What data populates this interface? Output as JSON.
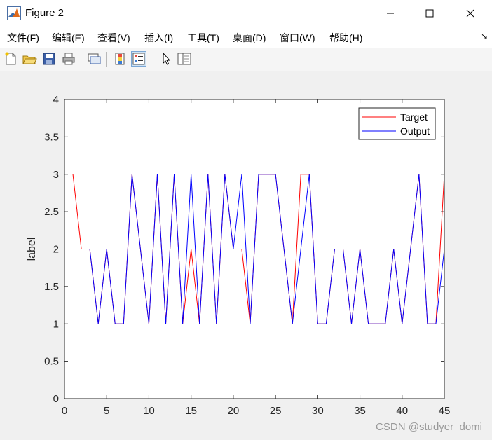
{
  "window": {
    "title": "Figure 2",
    "minimize_icon": "minimize-icon",
    "maximize_icon": "maximize-icon",
    "close_icon": "close-icon"
  },
  "menu": {
    "items": [
      "文件(F)",
      "编辑(E)",
      "查看(V)",
      "插入(I)",
      "工具(T)",
      "桌面(D)",
      "窗口(W)",
      "帮助(H)"
    ],
    "overflow_icon": "dock-arrow-icon"
  },
  "toolbar": {
    "buttons": [
      "new-figure-icon",
      "open-file-icon",
      "save-icon",
      "print-icon",
      "link-plot-icon",
      "colorbar-icon",
      "legend-icon",
      "pointer-icon",
      "property-inspector-icon"
    ]
  },
  "colors": {
    "target": "#ff0000",
    "output": "#0000ff",
    "axes_bg": "#ffffff",
    "figure_bg": "#f0f0f0"
  },
  "chart_data": {
    "type": "line",
    "title": "",
    "xlabel": "",
    "ylabel": "label",
    "xlim": [
      0,
      45
    ],
    "ylim": [
      0,
      4
    ],
    "xticks": [
      0,
      5,
      10,
      15,
      20,
      25,
      30,
      35,
      40,
      45
    ],
    "yticks": [
      0,
      0.5,
      1,
      1.5,
      2,
      2.5,
      3,
      3.5,
      4
    ],
    "ytick_labels": [
      "0",
      "0.5",
      "1",
      "1.5",
      "2",
      "2.5",
      "3",
      "3.5",
      "4"
    ],
    "grid": false,
    "legend_position": "top-right",
    "x": [
      1,
      2,
      3,
      4,
      5,
      6,
      7,
      8,
      9,
      10,
      11,
      12,
      13,
      14,
      15,
      16,
      17,
      18,
      19,
      20,
      21,
      22,
      23,
      24,
      25,
      26,
      27,
      28,
      29,
      30,
      31,
      32,
      33,
      34,
      35,
      36,
      37,
      38,
      39,
      40,
      41,
      42,
      43,
      44,
      45
    ],
    "series": [
      {
        "name": "Target",
        "color": "#ff0000",
        "values": [
          3,
          2,
          2,
          1,
          2,
          1,
          1,
          3,
          2,
          1,
          3,
          1,
          3,
          1,
          2,
          1,
          3,
          1,
          3,
          2,
          2,
          1,
          3,
          3,
          3,
          2,
          1,
          3,
          3,
          1,
          1,
          2,
          2,
          1,
          2,
          1,
          1,
          1,
          2,
          1,
          2,
          3,
          1,
          1,
          3
        ]
      },
      {
        "name": "Output",
        "color": "#0000ff",
        "values": [
          2,
          2,
          2,
          1,
          2,
          1,
          1,
          3,
          2,
          1,
          3,
          1,
          3,
          1,
          3,
          1,
          3,
          1,
          3,
          2,
          3,
          1,
          3,
          3,
          3,
          2,
          1,
          2,
          3,
          1,
          1,
          2,
          2,
          1,
          2,
          1,
          1,
          1,
          2,
          1,
          2,
          3,
          1,
          1,
          2
        ]
      }
    ]
  },
  "watermark": "CSDN @studyer_domi"
}
